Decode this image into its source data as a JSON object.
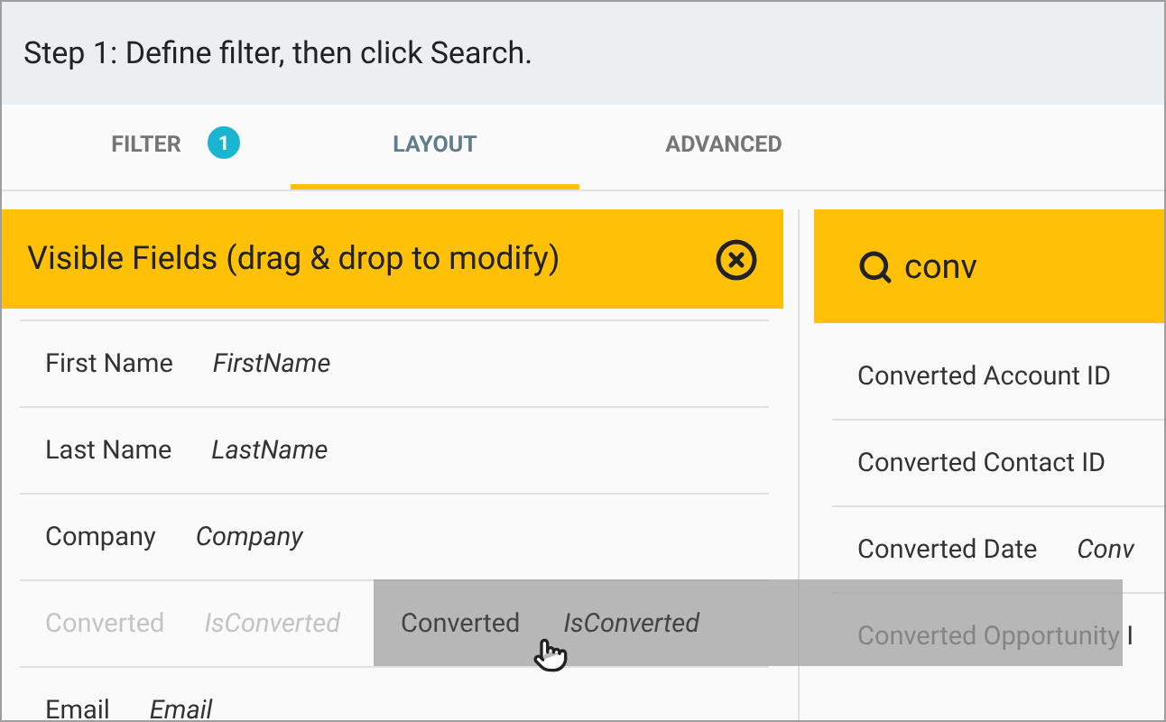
{
  "step_title": "Step 1: Define filter, then click Search.",
  "tabs": [
    {
      "label": "FILTER",
      "selected": false,
      "badge": "1"
    },
    {
      "label": "LAYOUT",
      "selected": true
    },
    {
      "label": "ADVANCED",
      "selected": false
    }
  ],
  "visible_fields": {
    "title": "Visible Fields (drag & drop to modify)",
    "rows": [
      {
        "label": "First Name",
        "api": "FirstName",
        "dragging": false
      },
      {
        "label": "Last Name",
        "api": "LastName",
        "dragging": false
      },
      {
        "label": "Company",
        "api": "Company",
        "dragging": false
      },
      {
        "label": "Converted",
        "api": "IsConverted",
        "dragging": true
      },
      {
        "label": "Email",
        "api": "Email",
        "dragging": false
      }
    ]
  },
  "available_fields": {
    "search": {
      "value": "conv"
    },
    "rows": [
      {
        "label": "Converted Account ID"
      },
      {
        "label": "Converted Contact ID"
      },
      {
        "label": "Converted Date",
        "api": "Conv"
      },
      {
        "label": "Converted Opportunity I"
      }
    ]
  },
  "drag_ghost": {
    "label": "Converted",
    "api": "IsConverted"
  }
}
